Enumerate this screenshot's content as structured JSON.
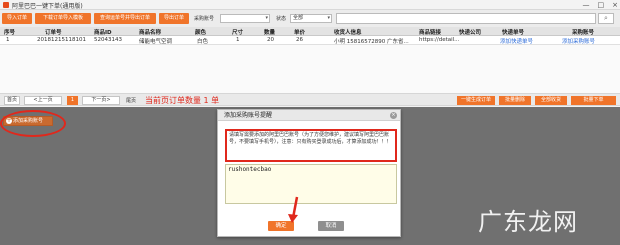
{
  "window": {
    "title": "阿里巴巴一键下单(通用版)",
    "controls": [
      "—",
      "□",
      "×"
    ]
  },
  "toolbar": {
    "buttons": [
      "导入订单",
      "下载订单导入模板",
      "查询运单号并导出订单",
      "导出订单"
    ],
    "filter_label": "采购账号",
    "status_label": "状态",
    "status_value": "全部",
    "search_placeholder": ""
  },
  "table": {
    "columns": [
      "序号",
      "订单号",
      "商品ID",
      "商品名称",
      "颜色",
      "尺寸",
      "数量",
      "单价",
      "收货人信息",
      "商品链接",
      "快递公司",
      "快递单号",
      "采购账号"
    ],
    "rows": [
      [
        "1",
        "20181215118101",
        "52043143",
        "储能电气空调",
        "白色",
        "1",
        "20",
        "26",
        "小明 15816572890 广东省...",
        "https://detail...",
        "",
        "添加快递单号",
        "添加采购账号"
      ]
    ]
  },
  "pager": {
    "first": "首页",
    "prev": "<上一页",
    "current": "1",
    "next": "下一页>",
    "last": "尾页",
    "count_text": "当前页订单数量 1 单",
    "op_buttons": [
      "一键生成订单",
      "批量删除",
      "全部收货",
      "批量下单"
    ]
  },
  "purchase_button": "添加采购账号",
  "dialog": {
    "title": "添加采购账号提醒",
    "notice": "请填写需要添加的阿里巴巴账号（为了方便您维护，建议填写阿里巴巴账号，不要填写手机号），注意：只有购买登录成功后，才算添加成功！！！",
    "input_value": "rushontecbao",
    "ok": "确定",
    "cancel": "取消"
  },
  "watermark": "广东龙网",
  "colors": {
    "accent": "#f0742a",
    "highlight": "#e0281c",
    "link": "#2c6bd8"
  }
}
